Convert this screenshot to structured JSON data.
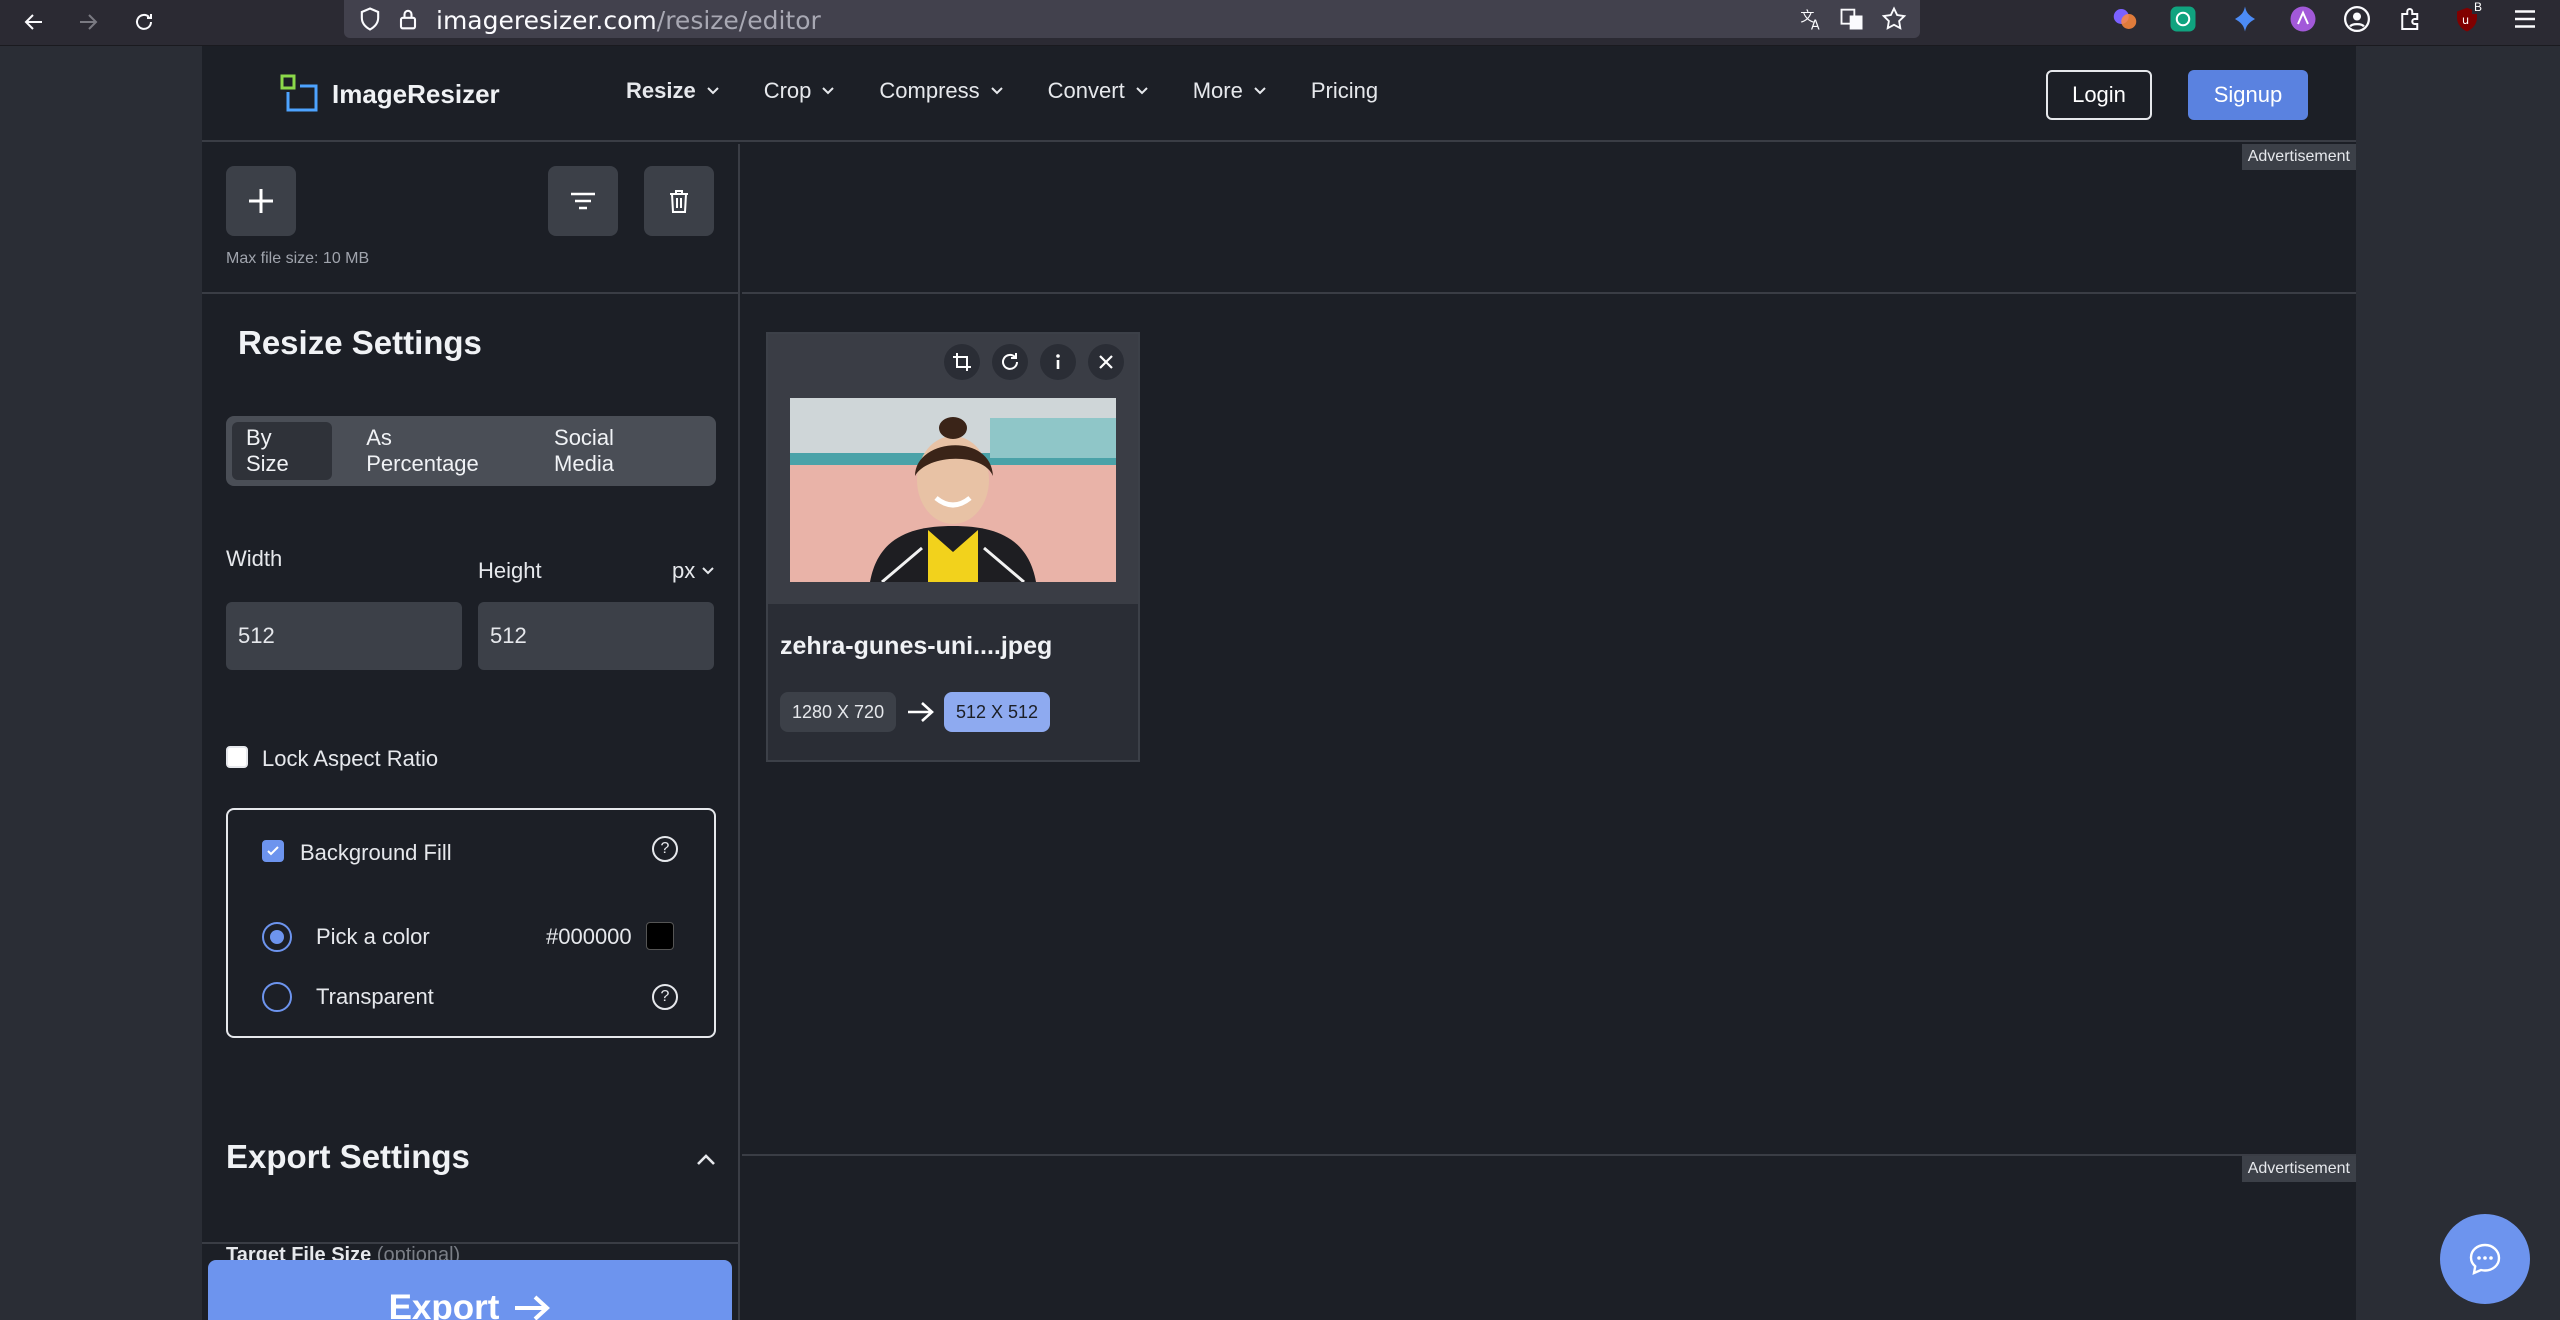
{
  "browser": {
    "url_host": "imageresizer.com",
    "url_path": "/resize/editor",
    "profile_badge": "B"
  },
  "header": {
    "logo_text": "ImageResizer",
    "menu": [
      {
        "label": "Resize",
        "dropdown": true
      },
      {
        "label": "Crop",
        "dropdown": true
      },
      {
        "label": "Compress",
        "dropdown": true
      },
      {
        "label": "Convert",
        "dropdown": true
      },
      {
        "label": "More",
        "dropdown": true
      },
      {
        "label": "Pricing",
        "dropdown": false
      }
    ],
    "login_label": "Login",
    "signup_label": "Signup"
  },
  "sidebar": {
    "max_file_size": "Max file size: 10 MB",
    "resize_title": "Resize Settings",
    "tabs": [
      "By Size",
      "As Percentage",
      "Social Media"
    ],
    "width_label": "Width",
    "height_label": "Height",
    "unit": "px",
    "width_value": "512",
    "height_value": "512",
    "lock_aspect_label": "Lock Aspect Ratio",
    "lock_aspect_checked": false,
    "background_fill_label": "Background Fill",
    "background_fill_checked": true,
    "pick_color_label": "Pick a color",
    "color_value": "#000000",
    "transparent_label": "Transparent",
    "export_title": "Export Settings",
    "target_file_size_label": "Target File Size",
    "target_file_size_optional": "(optional)",
    "export_label": "Export"
  },
  "main": {
    "ad_label_top": "Advertisement",
    "ad_label_bottom": "Advertisement",
    "file": {
      "name": "zehra-gunes-uni....jpeg",
      "original_dims": "1280 X 720",
      "new_dims": "512 X 512"
    }
  },
  "colors": {
    "accent": "#6d94ee",
    "background": "#1c1f26",
    "panel": "#3c4048"
  }
}
